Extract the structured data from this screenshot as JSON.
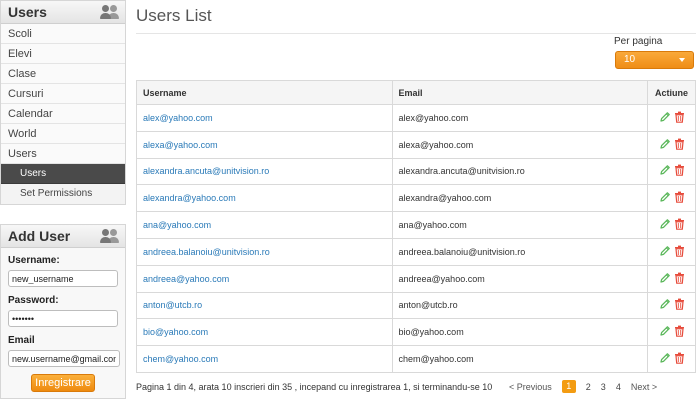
{
  "sidebar": {
    "title": "Users",
    "items": [
      {
        "label": "Scoli"
      },
      {
        "label": "Elevi"
      },
      {
        "label": "Clase"
      },
      {
        "label": "Cursuri"
      },
      {
        "label": "Calendar"
      },
      {
        "label": "World"
      },
      {
        "label": "Users"
      },
      {
        "label": "Users",
        "sub": true,
        "active": true
      },
      {
        "label": "Set Permissions",
        "sub": true
      }
    ]
  },
  "add_user": {
    "title": "Add User",
    "username_label": "Username:",
    "username_value": "new_username",
    "password_label": "Password:",
    "password_value": "•••••••",
    "email_label": "Email",
    "email_value": "new.username@gmail.com",
    "submit_label": "Inregistrare"
  },
  "main": {
    "title": "Users List",
    "per_page_label": "Per pagina",
    "per_page_value": "10",
    "columns": [
      "Username",
      "Email",
      "Actiune"
    ],
    "rows": [
      {
        "username": "alex@yahoo.com",
        "email": "alex@yahoo.com"
      },
      {
        "username": "alexa@yahoo.com",
        "email": "alexa@yahoo.com"
      },
      {
        "username": "alexandra.ancuta@unitvision.ro",
        "email": "alexandra.ancuta@unitvision.ro"
      },
      {
        "username": "alexandra@yahoo.com",
        "email": "alexandra@yahoo.com"
      },
      {
        "username": "ana@yahoo.com",
        "email": "ana@yahoo.com"
      },
      {
        "username": "andreea.balanoiu@unitvision.ro",
        "email": "andreea.balanoiu@unitvision.ro"
      },
      {
        "username": "andreea@yahoo.com",
        "email": "andreea@yahoo.com"
      },
      {
        "username": "anton@utcb.ro",
        "email": "anton@utcb.ro"
      },
      {
        "username": "bio@yahoo.com",
        "email": "bio@yahoo.com"
      },
      {
        "username": "chem@yahoo.com",
        "email": "chem@yahoo.com"
      }
    ],
    "pagination": {
      "info": "Pagina 1 din 4, arata 10 inscrieri din 35 , incepand cu inregistrarea 1, si terminandu-se 10",
      "prev_label": "< Previous",
      "pages": [
        "1",
        "2",
        "3",
        "4"
      ],
      "current": "1",
      "next_label": "Next >"
    }
  },
  "colors": {
    "accent": "#f39c12",
    "link": "#2a7ab8",
    "edit_icon": "#5cb85c",
    "delete_icon": "#e74c3c",
    "active_nav": "#4a4a4a"
  },
  "icons": {
    "panel": "users-icon",
    "edit": "pencil-icon",
    "delete": "trash-icon"
  }
}
